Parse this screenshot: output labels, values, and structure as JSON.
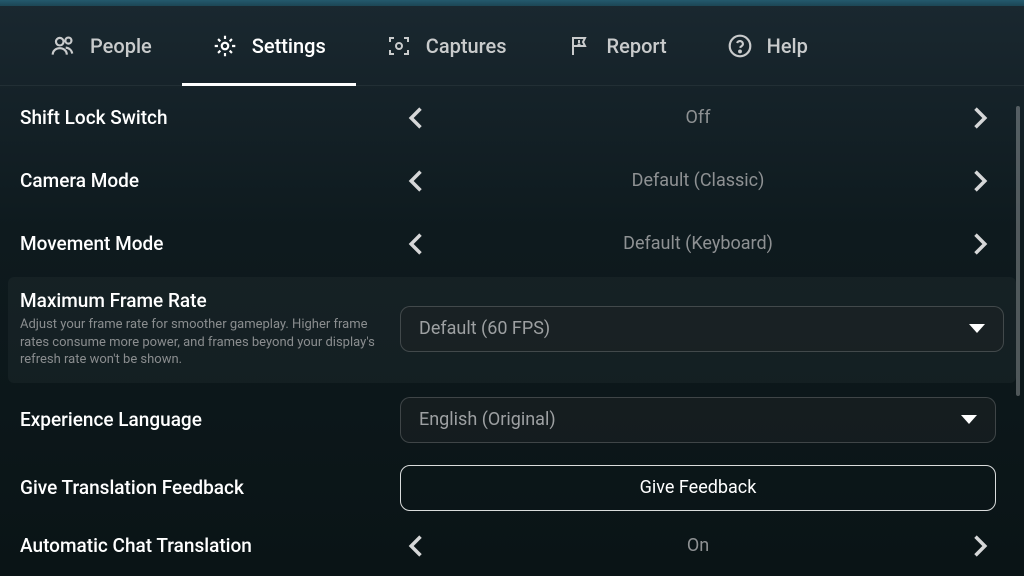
{
  "tabs": {
    "people": "People",
    "settings": "Settings",
    "captures": "Captures",
    "report": "Report",
    "help": "Help"
  },
  "settings": {
    "shift_lock": {
      "label": "Shift Lock Switch",
      "value": "Off"
    },
    "camera_mode": {
      "label": "Camera Mode",
      "value": "Default (Classic)"
    },
    "movement_mode": {
      "label": "Movement Mode",
      "value": "Default (Keyboard)"
    },
    "max_frame_rate": {
      "label": "Maximum Frame Rate",
      "desc": "Adjust your frame rate for smoother gameplay. Higher frame rates consume more power, and frames beyond your display's refresh rate won't be shown.",
      "value": "Default (60 FPS)"
    },
    "experience_language": {
      "label": "Experience Language",
      "value": "English (Original)"
    },
    "translation_feedback": {
      "label": "Give Translation Feedback",
      "button": "Give Feedback"
    },
    "auto_chat_translation": {
      "label": "Automatic Chat Translation",
      "value": "On"
    }
  }
}
